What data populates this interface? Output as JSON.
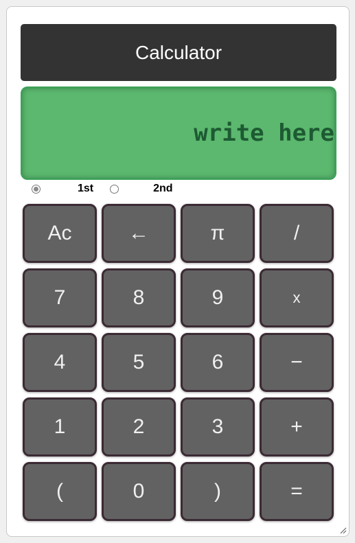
{
  "app": {
    "title": "Calculator"
  },
  "display": {
    "placeholder": "write here",
    "value": ""
  },
  "modes": [
    {
      "label": "1st",
      "checked": true
    },
    {
      "label": "2nd",
      "checked": false
    }
  ],
  "keys": [
    [
      "Ac",
      "←",
      "π",
      "/"
    ],
    [
      "7",
      "8",
      "9",
      "x"
    ],
    [
      "4",
      "5",
      "6",
      "−"
    ],
    [
      "1",
      "2",
      "3",
      "+"
    ],
    [
      "(",
      "0",
      ")",
      "="
    ]
  ],
  "colors": {
    "title_bg": "#333333",
    "display_bg": "#5bb86e",
    "display_text": "#1d5a32",
    "key_bg": "#626262",
    "key_border": "#3b2a33"
  }
}
